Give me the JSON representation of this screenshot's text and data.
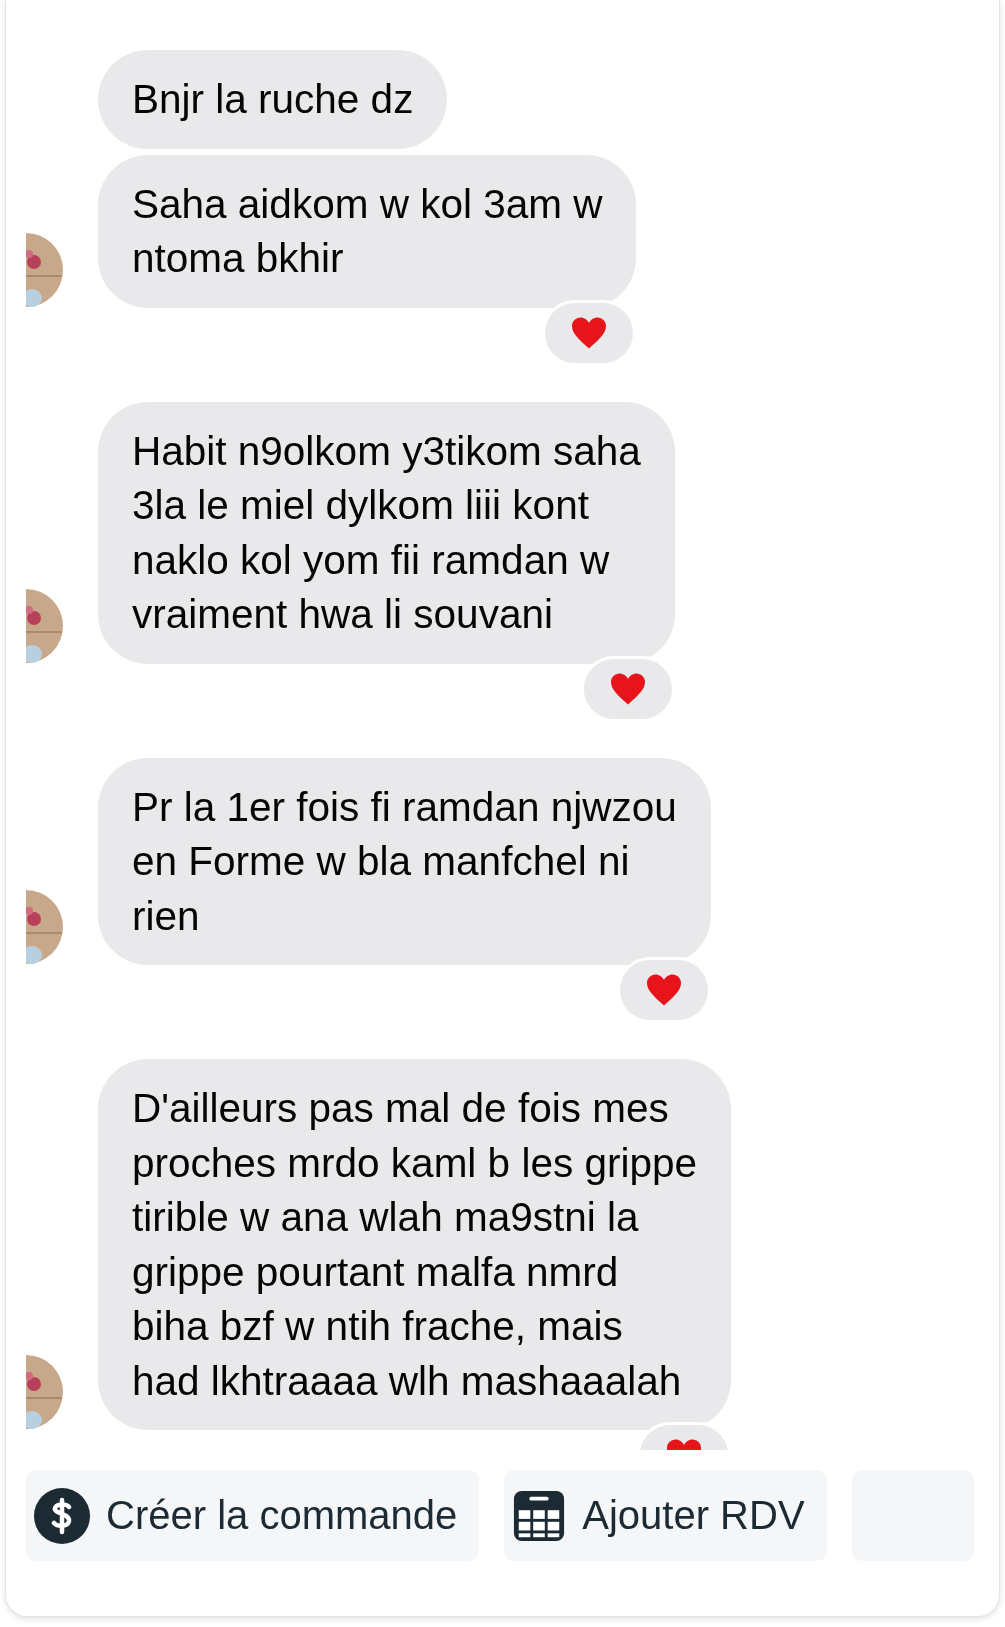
{
  "messages": [
    {
      "text": "Bnjr la ruche dz",
      "avatar": false,
      "reaction": false
    },
    {
      "text": "Saha aidkom w kol 3am w\nntoma bkhir",
      "avatar": true,
      "reaction": true
    },
    {
      "text": "Habit n9olkom y3tikom saha\n3la le miel dylkom liii kont\nnaklo kol yom fii ramdan w\nvraiment hwa li souvani",
      "avatar": true,
      "reaction": true
    },
    {
      "text": "Pr la 1er fois fi ramdan njwzou\nen Forme w bla manfchel ni\nrien",
      "avatar": true,
      "reaction": true
    },
    {
      "text": "D'ailleurs pas mal de fois mes\nproches mrdo kaml b les grippe\ntirible w ana wlah ma9stni la\ngrippe pourtant malfa nmrd\nbiha bzf w ntih frache, mais\nhad lkhtraaaa wlh mashaaalah",
      "avatar": true,
      "reaction": true
    }
  ],
  "actions": [
    {
      "kind": "order",
      "label": "Créer la commande"
    },
    {
      "kind": "appointment",
      "label": "Ajouter RDV"
    },
    {
      "kind": "more"
    }
  ]
}
